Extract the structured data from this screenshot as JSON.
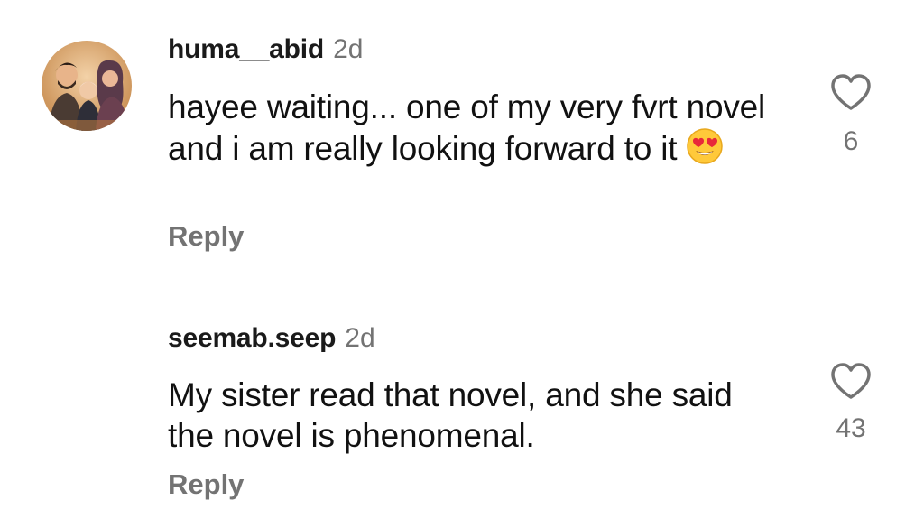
{
  "comments": [
    {
      "username": "huma__abid",
      "time": "2d",
      "text": "hayee waiting... one of my very fvrt novel and i am really looking forward to it",
      "emoji": "heart-eyes-emoji",
      "reply_label": "Reply",
      "like_icon": "heart-outline-icon",
      "like_count": "6",
      "has_avatar": true
    },
    {
      "username": "seemab.seep",
      "time": "2d",
      "text": "My sister read that novel, and she said the novel is phenomenal.",
      "reply_label": "Reply",
      "like_icon": "heart-outline-icon",
      "like_count": "43",
      "has_avatar": false
    }
  ],
  "colors": {
    "background": "#ffffff",
    "text": "#111111",
    "secondary": "#737373",
    "icon_stroke": "#737373"
  }
}
